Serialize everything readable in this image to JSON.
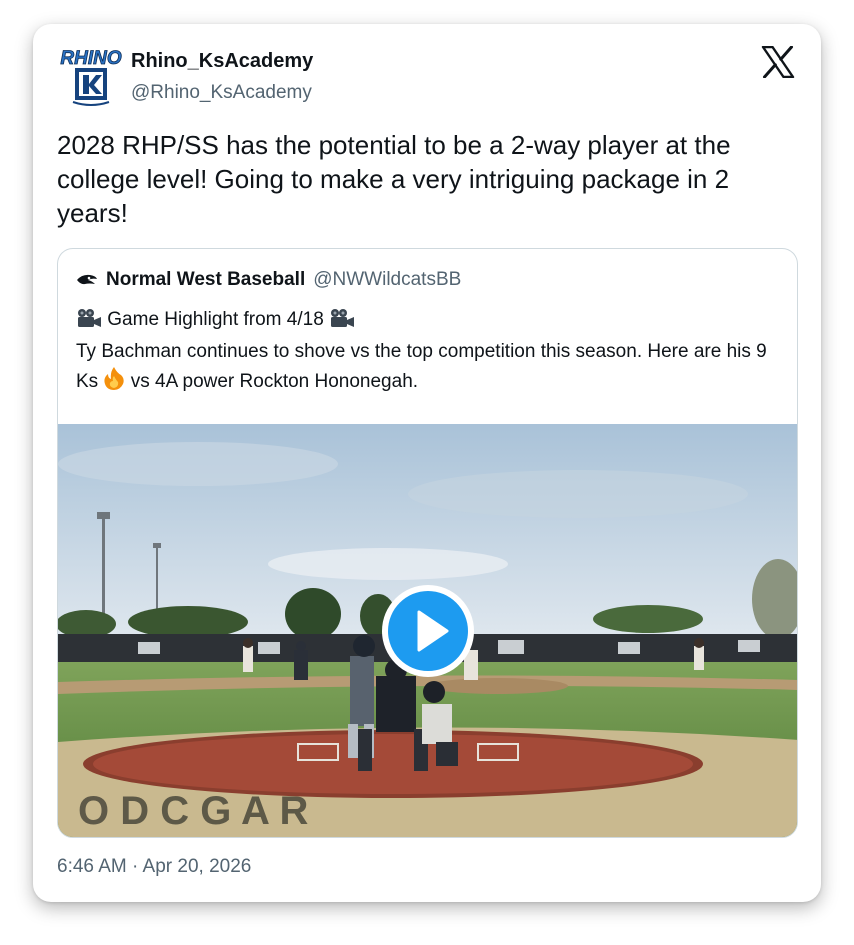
{
  "author": {
    "display_name": "Rhino_KsAcademy",
    "handle": "@Rhino_KsAcademy",
    "avatar_text": "RHINO"
  },
  "tweet": {
    "text": "2028 RHP/SS has the potential to be a 2-way player at the college level! Going to make a very intriguing package in 2 years!",
    "timestamp": "6:46 AM · Apr 20, 2026"
  },
  "quoted": {
    "display_name": "Normal West Baseball",
    "handle": "@NWWildcatsBB",
    "line1": "Game Highlight from 4/18",
    "line2_before_emoji": "Ty Bachman continues to shove vs the top competition this season. Here are his 9 Ks",
    "line2_after_emoji": "vs 4A power Rockton Hononegah.",
    "video_emoji": "video-camera-icon",
    "fire_emoji": "fire-icon"
  },
  "colors": {
    "text": "#0f1419",
    "secondary": "#536471",
    "play_button": "#1d9bf0"
  }
}
